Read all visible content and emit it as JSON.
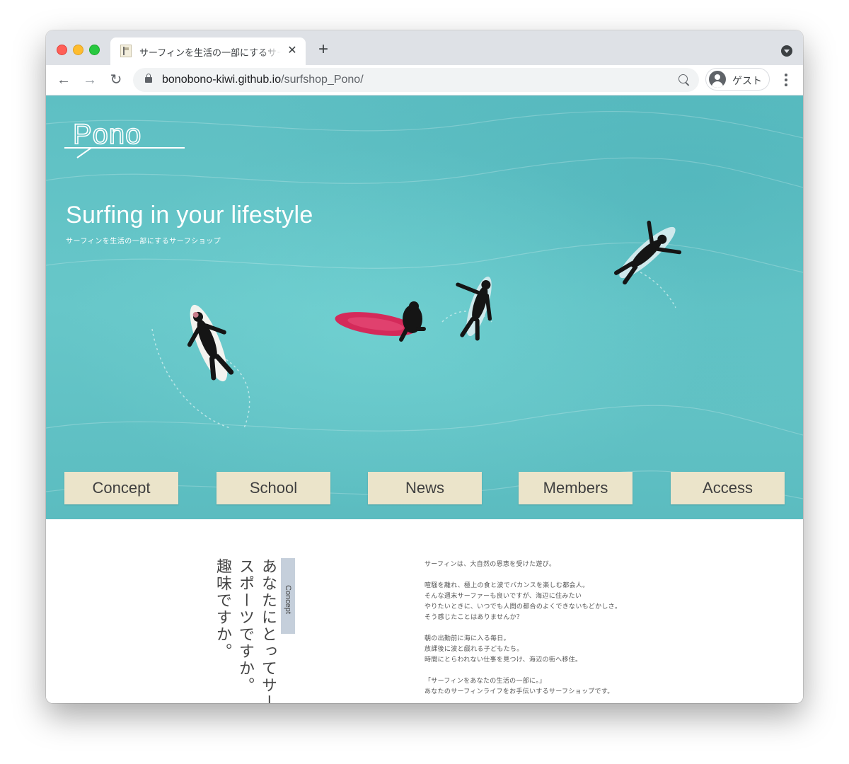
{
  "browser": {
    "tab": {
      "title": "サーフィンを生活の一部にするサーフショップ",
      "close_icon": "close-icon"
    },
    "new_tab_label": "+",
    "url_host": "bonobono-kiwi.github.io",
    "url_path": "/surfshop_Pono/",
    "profile_label": "ゲスト",
    "nav": {
      "back_glyph": "←",
      "forward_glyph": "→",
      "reload_glyph": "↻"
    }
  },
  "site": {
    "logo_text": "Pono",
    "hero": {
      "heading": "Surfing in your lifestyle",
      "subheading": "サーフィンを生活の一部にするサーフショップ"
    },
    "nav_items": [
      "Concept",
      "School",
      "News",
      "Members",
      "Access"
    ],
    "concept": {
      "label": "Concept",
      "heading": "あなたにとってサーフィンは スポーツですか。 趣味ですか。",
      "heading_lines": [
        "あなたにとってサーフ",
        "スポーツですか。",
        "趣味ですか。"
      ],
      "paragraphs": [
        [
          "サーフィンは、大自然の恩恵を受けた遊び。"
        ],
        [
          "喧騒を離れ、極上の食と波でバカンスを楽しむ都会人。",
          "そんな週末サーファーも良いですが、海辺に住みたい",
          "やりたいときに、いつでも人間の都合のよくできないもどかしさ。",
          "そう感じたことはありませんか？"
        ],
        [
          "朝の出勤前に海に入る毎日。",
          "放課後に波と戯れる子どもたち。",
          "時間にとらわれない仕事を見つけ、海辺の街へ移住。"
        ],
        [
          "「サーフィンをあなたの生活の一部に。」",
          "あなたのサーフィンライフをお手伝いするサーフショップです。"
        ]
      ]
    }
  },
  "colors": {
    "sea": "#64c4c7",
    "nav_button_bg": "#ebe4ca",
    "concept_label_bg": "#c5cfdb",
    "surfboard_red": "#d42a5a"
  }
}
